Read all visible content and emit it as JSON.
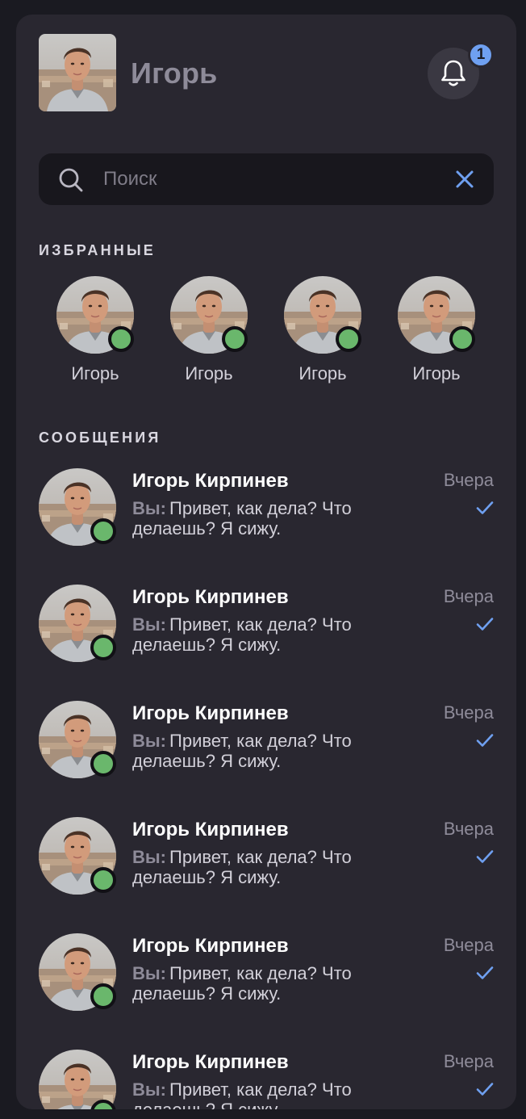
{
  "header": {
    "user_name": "Игорь",
    "notifications_count": "1",
    "bell_icon": "bell-icon"
  },
  "search": {
    "placeholder": "Поиск",
    "value": "",
    "search_icon": "search-icon",
    "clear_icon": "close-icon"
  },
  "favorites": {
    "label": "ИЗБРАННЫЕ",
    "items": [
      {
        "name": "Игорь",
        "online": true
      },
      {
        "name": "Игорь",
        "online": true
      },
      {
        "name": "Игорь",
        "online": true
      },
      {
        "name": "Игорь",
        "online": true
      }
    ]
  },
  "messages": {
    "label": "СООБЩЕНИЯ",
    "items": [
      {
        "name": "Игорь Кирпинев",
        "prefix": "Вы:",
        "text": "Привет, как дела? Что делаешь? Я сижу.",
        "time": "Вчера",
        "status": "read-check-icon"
      },
      {
        "name": "Игорь Кирпинев",
        "prefix": "Вы:",
        "text": "Привет, как дела? Что делаешь? Я сижу.",
        "time": "Вчера",
        "status": "read-check-icon"
      },
      {
        "name": "Игорь Кирпинев",
        "prefix": "Вы:",
        "text": "Привет, как дела? Что делаешь? Я сижу.",
        "time": "Вчера",
        "status": "read-check-icon"
      },
      {
        "name": "Игорь Кирпинев",
        "prefix": "Вы:",
        "text": "Привет, как дела? Что делаешь? Я сижу.",
        "time": "Вчера",
        "status": "read-check-icon"
      },
      {
        "name": "Игорь Кирпинев",
        "prefix": "Вы:",
        "text": "Привет, как дела? Что делаешь? Я сижу.",
        "time": "Вчера",
        "status": "read-check-icon"
      },
      {
        "name": "Игорь Кирпинев",
        "prefix": "Вы:",
        "text": "Привет, как дела? Что делаешь? Я сижу.",
        "time": "Вчера",
        "status": "read-check-icon"
      }
    ]
  },
  "colors": {
    "panel": "#292730",
    "accent": "#6fa0f1",
    "online": "#6ab76c",
    "muted": "#8e8b99"
  }
}
